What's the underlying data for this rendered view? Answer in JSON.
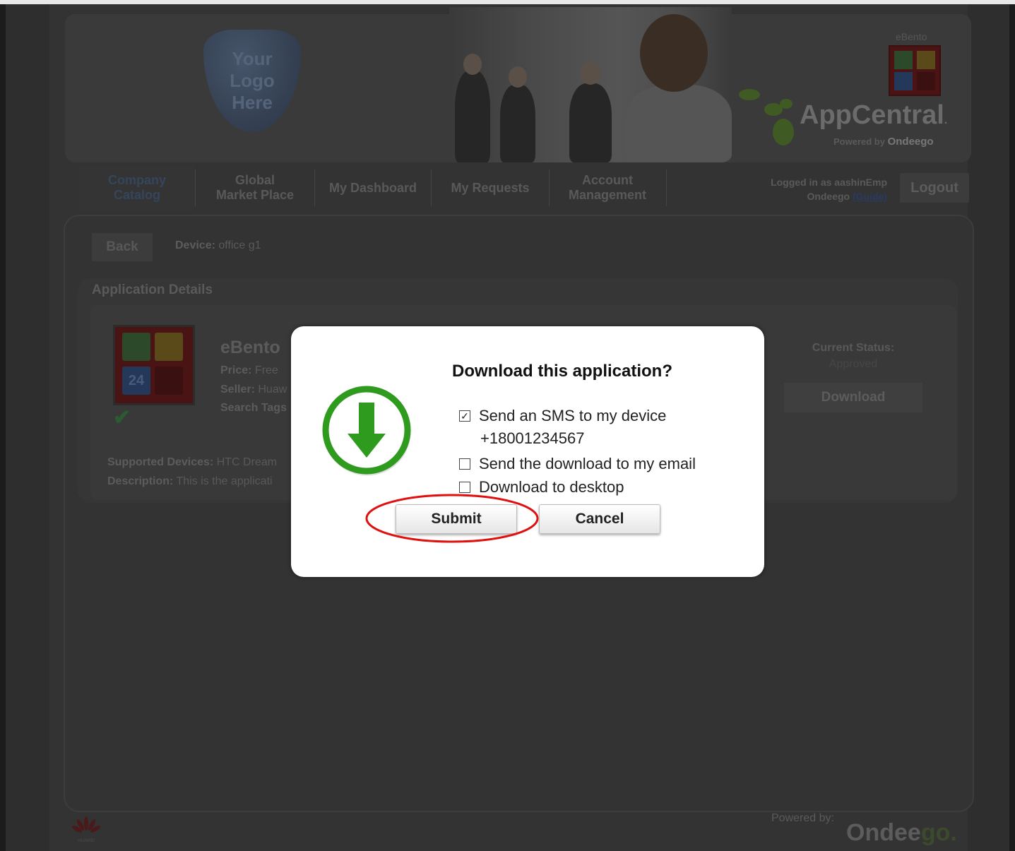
{
  "header": {
    "logo_placeholder": [
      "Your",
      "Logo",
      "Here"
    ],
    "app_title": "AppCentral",
    "tm_mark": ".",
    "powered_by_label": "Powered by",
    "powered_by_brand": "Ondeego",
    "mini_app_label": "eBento"
  },
  "nav": {
    "tabs": [
      {
        "label": "Company\nCatalog",
        "active": true
      },
      {
        "label": "Global\nMarket Place",
        "active": false
      },
      {
        "label": "My Dashboard",
        "active": false
      },
      {
        "label": "My Requests",
        "active": false
      },
      {
        "label": "Account\nManagement",
        "active": false
      }
    ],
    "login_line1": "Logged in as aashinEmp",
    "login_line2_prefix": "Ondeego ",
    "guide_link": "(Guide)",
    "logout_label": "Logout"
  },
  "content": {
    "back_label": "Back",
    "device_label": "Device:",
    "device_value": " office g1",
    "section_title": "Application Details",
    "app_name": "eBento",
    "price_label": "Price:",
    "price_value": " Free",
    "seller_label": "Seller:",
    "seller_value": " Huaw",
    "tags_label": "Search Tags",
    "supported_label": "Supported Devices:",
    "supported_value": " HTC Dream",
    "description_label": "Description:",
    "description_value": " This is the applicati",
    "status_label": "Current Status:",
    "status_value": "Approved",
    "download_label": "Download",
    "icon_number": "24"
  },
  "footer": {
    "powered_by": "Powered by:",
    "brand_main": "Ondee",
    "brand_accent": "go.",
    "huawei_label": "HUAWEI"
  },
  "modal": {
    "title": "Download this application?",
    "options": [
      {
        "label": "Send an SMS to my device",
        "checked": true
      },
      {
        "label": "Send the download to my email",
        "checked": false
      },
      {
        "label": "Download to desktop",
        "checked": false
      }
    ],
    "phone": "+18001234567",
    "submit_label": "Submit",
    "cancel_label": "Cancel"
  },
  "colors": {
    "download_green": "#2e9a1e",
    "highlight_red": "#e01010"
  }
}
